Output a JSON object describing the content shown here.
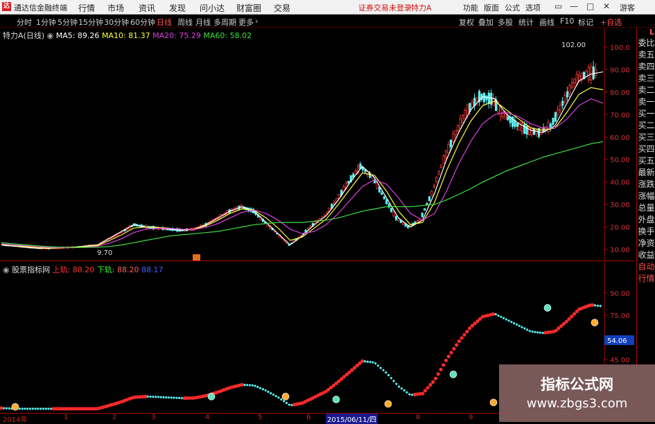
{
  "menubar": {
    "app_title": "通达信金融终端",
    "menus": [
      "行情",
      "市场",
      "资讯",
      "发现",
      "问小达",
      "财富圈",
      "交易"
    ],
    "notice": "证券交易未登录",
    "stock_name": "特力A",
    "right_menus": [
      "功能",
      "版面",
      "公式",
      "选项"
    ],
    "guest": "游客"
  },
  "periods": [
    "分时",
    "1分钟",
    "5分钟",
    "15分钟",
    "30分钟",
    "60分钟",
    "日线",
    "周线",
    "月线",
    "多周期",
    "更多"
  ],
  "active_period": "日线",
  "toolbar": [
    "复权",
    "叠加",
    "多股",
    "统计",
    "画线",
    "F10",
    "标记",
    "+自选"
  ],
  "main_legend": {
    "title": "特力A(日线)",
    "ma": [
      {
        "label": "MA5: 89.26",
        "color": "#ffffff"
      },
      {
        "label": "MA10: 81.37",
        "color": "#ffff40"
      },
      {
        "label": "MA20: 75.29",
        "color": "#e040e0"
      },
      {
        "label": "MA60: 58.02",
        "color": "#40e040"
      }
    ]
  },
  "indicator_legend": {
    "title": "股票指标网",
    "items": [
      {
        "label": "上轨: 88.20",
        "color": "#ff3030"
      },
      {
        "label": "下轨:",
        "color": "#30ff30"
      },
      {
        "label": "88.20",
        "color": "#ff6060"
      },
      {
        "label": "88.17",
        "color": "#4060ff"
      }
    ]
  },
  "main_yaxis": [
    "100.0",
    "90.00",
    "80.00",
    "70.00",
    "60.00",
    "50.00",
    "40.00",
    "30.00",
    "20.00",
    "10.00"
  ],
  "ind_yaxis": [
    "90.00",
    "75.00",
    "54.06",
    "45.00"
  ],
  "annotations": {
    "high": "102.00",
    "low": "9.70"
  },
  "xaxis": [
    "2014年",
    "1",
    "2",
    "3",
    "4",
    "5",
    "6",
    "2015/06/11/四",
    "8",
    "9",
    "10",
    "11",
    "12"
  ],
  "sidetabs": [
    "委比",
    "卖五",
    "卖四",
    "卖三",
    "卖二",
    "卖一",
    "买一",
    "买二",
    "买三",
    "买四",
    "买五",
    "最新",
    "涨跌",
    "涨幅",
    "总量",
    "外盘",
    "换手",
    "净资",
    "收益",
    "自动",
    "行情"
  ],
  "side_top": "L",
  "watermark": {
    "line1": "指标公式网",
    "line2": "www.zbgs3.com"
  },
  "chart_data": {
    "type": "line",
    "title": "特力A(日线)",
    "ylim": [
      8,
      106
    ],
    "x": [
      0,
      5,
      10,
      15,
      20,
      25,
      30,
      35,
      40,
      45,
      50,
      55,
      60,
      65,
      70,
      75,
      80,
      85,
      90,
      95,
      100,
      105,
      110,
      115,
      120,
      125,
      130,
      135,
      140,
      145,
      150,
      155,
      160,
      165,
      170,
      175,
      180,
      185,
      190,
      195,
      200,
      205,
      210,
      215,
      220,
      225,
      230,
      235,
      240,
      245,
      250
    ],
    "series": [
      {
        "name": "MA5",
        "values": [
          12,
          11.5,
          11,
          10.5,
          10.5,
          10.8,
          11,
          11.5,
          12,
          15,
          18,
          21,
          20,
          19.5,
          19,
          18.5,
          19,
          21,
          24,
          27,
          29,
          27,
          22,
          17,
          12,
          16,
          21,
          25,
          32,
          40,
          47,
          42,
          33,
          24,
          20,
          23,
          35,
          50,
          62,
          72,
          78,
          77,
          70,
          66,
          63,
          62,
          65,
          75,
          85,
          88,
          89
        ]
      },
      {
        "name": "MA10",
        "values": [
          12.2,
          11.8,
          11.3,
          10.8,
          10.6,
          10.7,
          10.9,
          11.3,
          11.8,
          14,
          16.5,
          19.5,
          20,
          19.7,
          19.3,
          18.9,
          19,
          20.5,
          23,
          26,
          28,
          27.5,
          24,
          19.5,
          14,
          15.5,
          19.5,
          23.5,
          30,
          37,
          44,
          43,
          36,
          27,
          21,
          22,
          31,
          45,
          57,
          67,
          74,
          76,
          72,
          68,
          64,
          63,
          64,
          71,
          79,
          82,
          81
        ]
      },
      {
        "name": "MA20",
        "values": [
          12.5,
          12,
          11.7,
          11.2,
          10.9,
          10.8,
          10.8,
          11,
          11.4,
          12.8,
          14.8,
          17.5,
          19,
          19.4,
          19.3,
          19,
          18.9,
          19.8,
          21.5,
          24,
          26.5,
          27.5,
          26,
          23,
          19,
          17,
          18,
          21,
          26,
          32,
          38,
          41,
          39,
          33,
          26,
          23,
          26,
          36,
          48,
          58,
          66,
          70,
          71,
          69,
          66,
          64,
          64,
          68,
          74,
          77,
          75
        ]
      },
      {
        "name": "MA60",
        "values": [
          13,
          12.5,
          12,
          11.6,
          11.2,
          11,
          10.9,
          10.9,
          11,
          11.3,
          12,
          13,
          14,
          15,
          16,
          16.5,
          17,
          17.5,
          18,
          19,
          20,
          21,
          21.5,
          22,
          22,
          22,
          22.5,
          23,
          24,
          25.5,
          27,
          28,
          29,
          29,
          29,
          29.5,
          30,
          32,
          34.5,
          37,
          40,
          42.5,
          45,
          47,
          49,
          51,
          52.5,
          54,
          55.5,
          57,
          58
        ]
      }
    ]
  }
}
